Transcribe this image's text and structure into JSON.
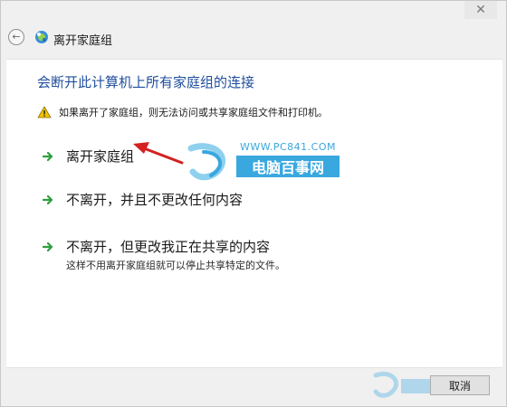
{
  "window": {
    "title": "离开家庭组",
    "close_glyph": "✕",
    "back_glyph": "←"
  },
  "content": {
    "heading": "会断开此计算机上所有家庭组的连接",
    "warning": "如果离开了家庭组，则无法访问或共享家庭组文件和打印机。",
    "options": [
      {
        "label": "离开家庭组"
      },
      {
        "label": "不离开，并且不更改任何内容"
      },
      {
        "label": "不离开，但更改我正在共享的内容",
        "sublabel": "这样不用离开家庭组就可以停止共享特定的文件。"
      }
    ]
  },
  "watermark": {
    "url": "WWW.PC841.COM",
    "brand": "电脑百事网"
  },
  "footer": {
    "cancel_label": "取消"
  },
  "icons": {
    "back": "back-arrow-icon",
    "app": "homegroup-icon",
    "warning": "warning-icon",
    "option_arrow": "green-arrow-icon"
  },
  "colors": {
    "heading": "#1f4e9c",
    "option_arrow": "#2e9e3e",
    "warning_fill": "#f2c200",
    "watermark_blue": "#39a8df",
    "annotation_red": "#d42020"
  }
}
